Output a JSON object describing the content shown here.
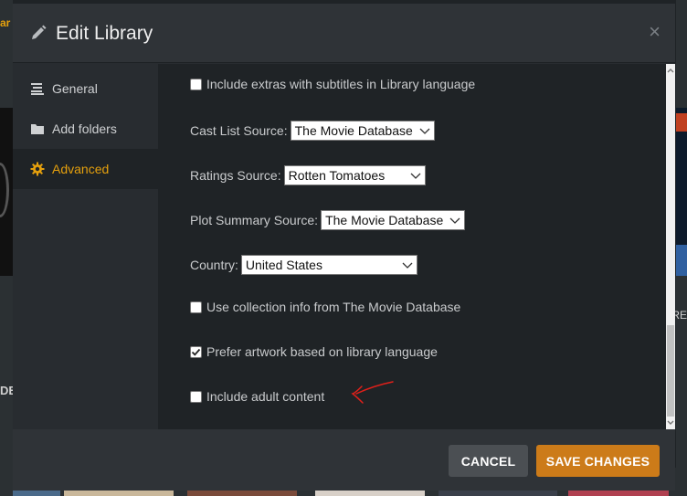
{
  "background": {
    "left_yellow_text": "ar",
    "left_text": "DE",
    "right_text": "RE"
  },
  "modal": {
    "title": "Edit Library",
    "close_symbol": "×"
  },
  "sidebar": {
    "items": [
      {
        "label": "General",
        "icon": "list-icon",
        "active": false
      },
      {
        "label": "Add folders",
        "icon": "folder-icon",
        "active": false
      },
      {
        "label": "Advanced",
        "icon": "gear-icon",
        "active": true
      }
    ]
  },
  "settings": {
    "include_extras_subtitles": {
      "label": "Include extras with subtitles in Library language",
      "checked": false
    },
    "cast_list_source": {
      "label": "Cast List Source:",
      "value": "The Movie Database"
    },
    "ratings_source": {
      "label": "Ratings Source:",
      "value": "Rotten Tomatoes"
    },
    "plot_summary_source": {
      "label": "Plot Summary Source:",
      "value": "The Movie Database"
    },
    "country": {
      "label": "Country:",
      "value": "United States"
    },
    "use_collection_info": {
      "label": "Use collection info from The Movie Database",
      "checked": false
    },
    "prefer_artwork": {
      "label": "Prefer artwork based on library language",
      "checked": true
    },
    "include_adult": {
      "label": "Include adult content",
      "checked": false
    }
  },
  "footer": {
    "cancel_label": "CANCEL",
    "save_label": "SAVE CHANGES"
  },
  "colors": {
    "accent": "#e5a00d",
    "save_button": "#cc7b19",
    "annotation_arrow": "#e0201a"
  }
}
